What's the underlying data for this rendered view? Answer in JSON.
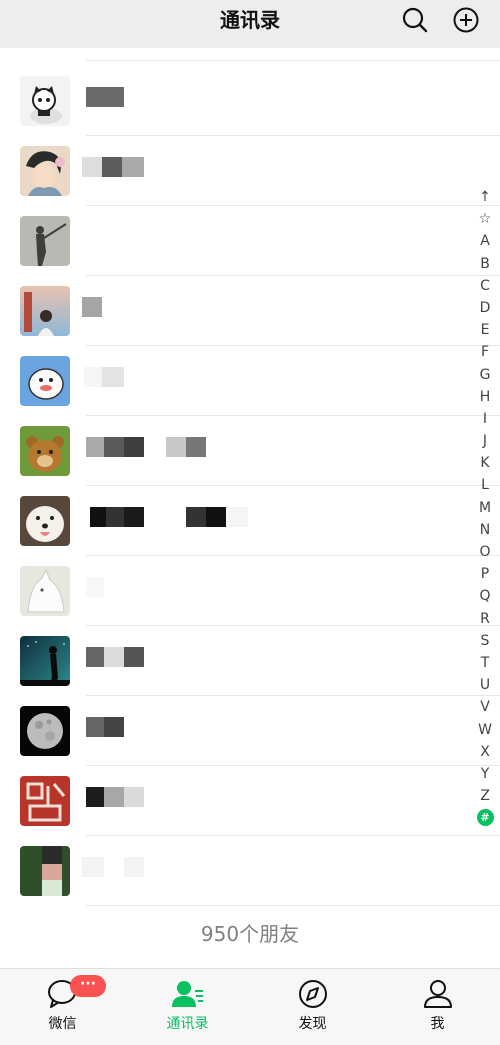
{
  "header": {
    "title": "通讯录",
    "icons": [
      "search-icon",
      "add-circle-icon"
    ]
  },
  "contacts": [
    {
      "avatar": "cat-avatar"
    },
    {
      "avatar": "anime-avatar"
    },
    {
      "avatar": "silhouette-avatar"
    },
    {
      "avatar": "girl-avatar"
    },
    {
      "avatar": "cartoon-avatar"
    },
    {
      "avatar": "bear-avatar"
    },
    {
      "avatar": "dog-avatar"
    },
    {
      "avatar": "wolf-avatar"
    },
    {
      "avatar": "night-sky-avatar"
    },
    {
      "avatar": "moon-avatar"
    },
    {
      "avatar": "seal-avatar"
    },
    {
      "avatar": "plant-avatar"
    }
  ],
  "index_letters": [
    "↑",
    "☆",
    "A",
    "B",
    "C",
    "D",
    "E",
    "F",
    "G",
    "H",
    "I",
    "J",
    "K",
    "L",
    "M",
    "N",
    "O",
    "P",
    "Q",
    "R",
    "S",
    "T",
    "U",
    "V",
    "W",
    "X",
    "Y",
    "Z",
    "#"
  ],
  "friend_count": "950个朋友",
  "tabbar": {
    "tabs": [
      {
        "label": "微信",
        "icon": "chat-bubble-icon",
        "badge": "···"
      },
      {
        "label": "通讯录",
        "icon": "contacts-icon",
        "active": true
      },
      {
        "label": "发现",
        "icon": "compass-icon"
      },
      {
        "label": "我",
        "icon": "person-icon"
      }
    ]
  },
  "colors": {
    "accent": "#07c160",
    "badge": "#fa5151",
    "header_bg": "#ededed",
    "tabbar_bg": "#f7f7f7"
  }
}
